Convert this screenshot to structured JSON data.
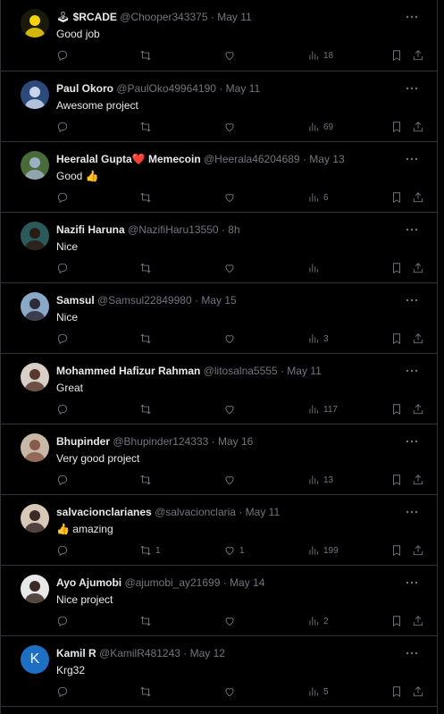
{
  "tweets": [
    {
      "prefix": "🕹",
      "name": "$RCADE",
      "handle": "@Chooper343375",
      "time": "May 11",
      "text": "Good job",
      "replies": "",
      "retweets": "",
      "likes": "",
      "views": "18",
      "avatar_color": "#1a1a0a",
      "avatar_accent": "#f5d20a"
    },
    {
      "prefix": "",
      "name": "Paul Okoro",
      "handle": "@PaulOko49964190",
      "time": "May 11",
      "text": "Awesome project",
      "replies": "",
      "retweets": "",
      "likes": "",
      "views": "69",
      "avatar_color": "#2b4a7a",
      "avatar_accent": "#c9d6ea"
    },
    {
      "prefix": "",
      "name": "Heeralal Gupta❤️ Memecoin",
      "handle": "@Heerala46204689",
      "time": "May 13",
      "text": "Good 👍",
      "replies": "",
      "retweets": "",
      "likes": "",
      "views": "6",
      "avatar_color": "#4a6a3a",
      "avatar_accent": "#9cb0c4"
    },
    {
      "prefix": "",
      "name": "Nazifi Haruna",
      "handle": "@NazifiHaru13550",
      "time": "8h",
      "text": "Nice",
      "replies": "",
      "retweets": "",
      "likes": "",
      "views": "",
      "avatar_color": "#2a5a5a",
      "avatar_accent": "#2a1a14"
    },
    {
      "prefix": "",
      "name": "Samsul",
      "handle": "@Samsul22849980",
      "time": "May 15",
      "text": "Nice",
      "replies": "",
      "retweets": "",
      "likes": "",
      "views": "3",
      "avatar_color": "#8aa8c8",
      "avatar_accent": "#2c2c3a"
    },
    {
      "prefix": "",
      "name": "Mohammed Hafizur Rahman",
      "handle": "@litosalna5555",
      "time": "May 11",
      "text": "Great",
      "replies": "",
      "retweets": "",
      "likes": "",
      "views": "117",
      "avatar_color": "#d8d0c8",
      "avatar_accent": "#5a3a2a"
    },
    {
      "prefix": "",
      "name": "Bhupinder",
      "handle": "@Bhupinder124333",
      "time": "May 16",
      "text": "Very good project",
      "replies": "",
      "retweets": "",
      "likes": "",
      "views": "13",
      "avatar_color": "#c8b8a8",
      "avatar_accent": "#8a5a4a"
    },
    {
      "prefix": "",
      "name": "salvacionclarianes",
      "handle": "@salvacionclaria",
      "time": "May 11",
      "text": "👍 amazing",
      "replies": "",
      "retweets": "1",
      "likes": "1",
      "views": "199",
      "avatar_color": "#d8c8b8",
      "avatar_accent": "#3a2a2a"
    },
    {
      "prefix": "",
      "name": "Ayo Ajumobi",
      "handle": "@ajumobi_ay21699",
      "time": "May 14",
      "text": "Nice project",
      "replies": "",
      "retweets": "",
      "likes": "",
      "views": "2",
      "avatar_color": "#e8e8e8",
      "avatar_accent": "#3a2a24"
    },
    {
      "prefix": "",
      "name": "Kamil R",
      "handle": "@KamilR481243",
      "time": "May 12",
      "text": "Krg32",
      "replies": "",
      "retweets": "",
      "likes": "",
      "views": "5",
      "avatar_color": "#1d6fc4",
      "avatar_accent": "#ffffff",
      "avatar_letter": "K"
    }
  ],
  "separator": "·"
}
